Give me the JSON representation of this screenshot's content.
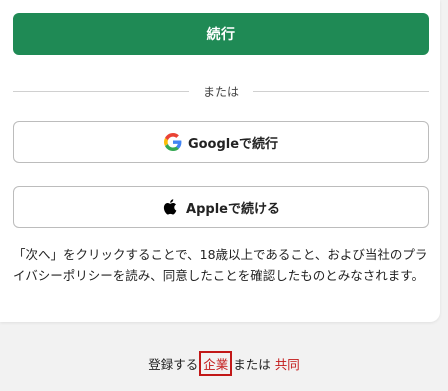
{
  "buttons": {
    "continue": "続行",
    "google": "Googleで続行",
    "apple": "Appleで続ける"
  },
  "divider": "または",
  "terms": "「次へ」をクリックすることで、18歳以上であること、および当社のプライバシーポリシーを読み、同意したことを確認したものとみなされます。",
  "footer": {
    "prefix": "登録する",
    "enterprise_link": "企業",
    "connector": "または",
    "partner_link": "共同"
  },
  "colors": {
    "primary": "#1f8a55",
    "link": "#c21818",
    "highlight_box": "#c21818"
  },
  "icons": {
    "google": "google-logo-icon",
    "apple": "apple-logo-icon"
  }
}
